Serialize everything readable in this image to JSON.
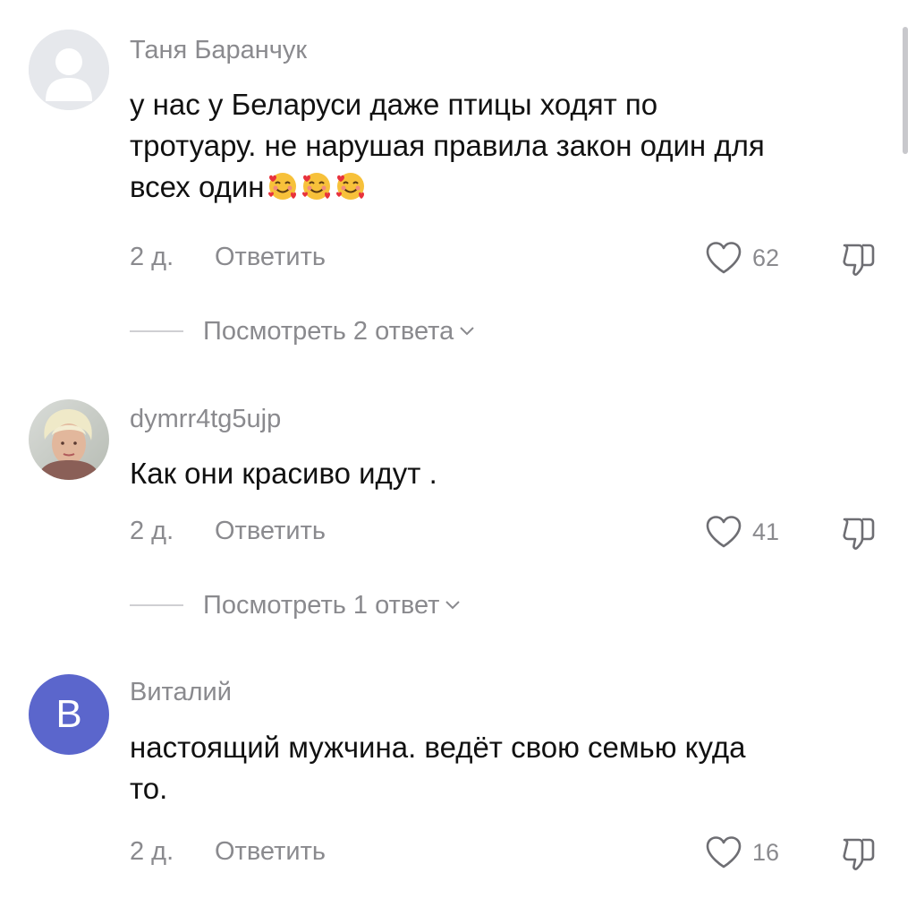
{
  "comments": [
    {
      "username": "Таня Баранчук",
      "avatar": "default-user-silhouette",
      "text_line1": "у нас у Беларуси даже птицы ходят по",
      "text_line2": "тротуару. не нарушая правила закон один для",
      "text_line3": "всех один",
      "emoji": "smiling-face-with-hearts",
      "emoji_count": 3,
      "date": "2 д.",
      "reply_label": "Ответить",
      "likes": "62",
      "view_replies": "Посмотреть 2 ответа"
    },
    {
      "username": "dymrr4tg5ujp",
      "avatar": "user-photo",
      "text": "Как они красиво идут .",
      "date": "2 д.",
      "reply_label": "Ответить",
      "likes": "41",
      "view_replies": "Посмотреть 1 ответ"
    },
    {
      "username": "Виталий",
      "avatar_letter": "В",
      "avatar_color": "#5b66cc",
      "text_line1": "настоящий мужчина. ведёт свою семью куда",
      "text_line2": "то.",
      "date": "2 д.",
      "reply_label": "Ответить",
      "likes": "16"
    }
  ],
  "colors": {
    "primary_text": "#111111",
    "secondary_text": "#8a8a8e",
    "background": "#ffffff"
  }
}
